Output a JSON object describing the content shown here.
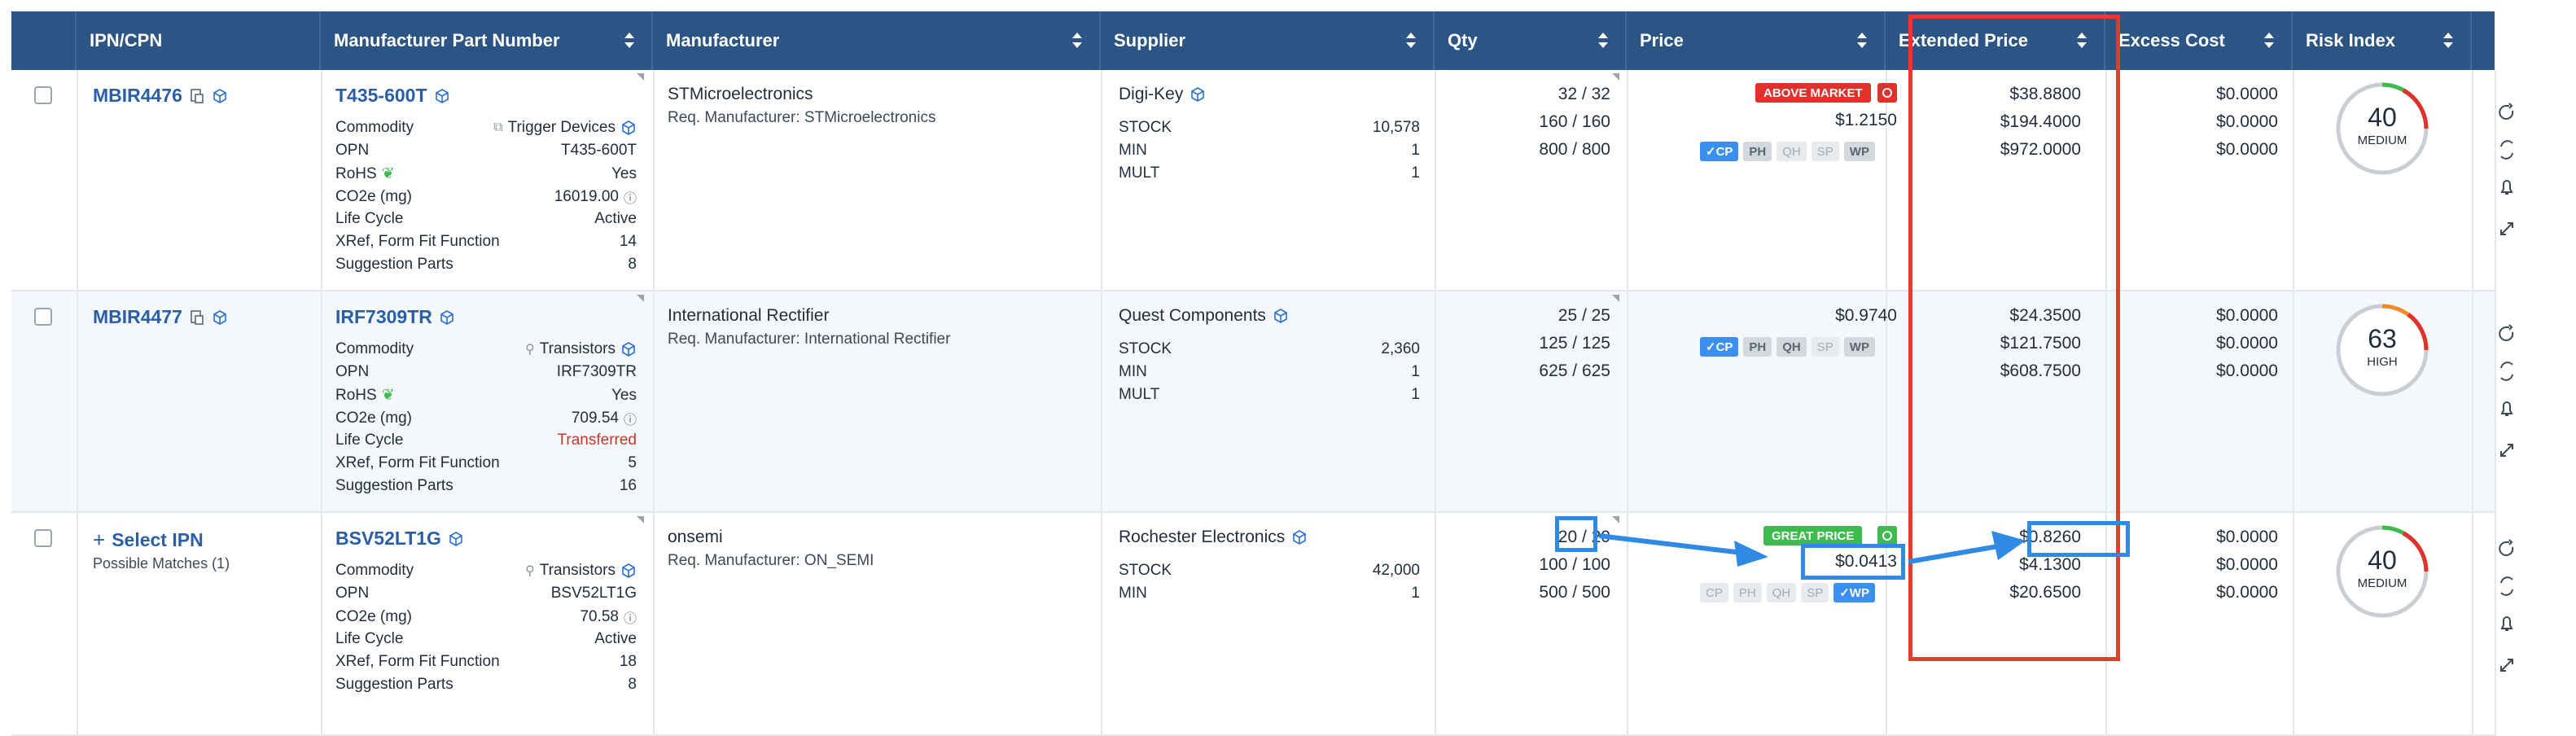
{
  "columns": [
    "IPN/CPN",
    "Manufacturer Part Number",
    "Manufacturer",
    "Supplier",
    "Qty",
    "Price",
    "Extended Price",
    "Excess Cost",
    "Risk Index"
  ],
  "rows": [
    {
      "ipn": "MBIR4476",
      "mpn": "T435-600T",
      "attrs": [
        {
          "k": "Commodity",
          "v": "Trigger Devices"
        },
        {
          "k": "OPN",
          "v": "T435-600T"
        },
        {
          "k": "RoHS",
          "v": "Yes"
        },
        {
          "k": "CO2e (mg)",
          "v": "16019.00"
        },
        {
          "k": "Life Cycle",
          "v": "Active"
        },
        {
          "k": "XRef, Form Fit Function",
          "v": "14"
        },
        {
          "k": "Suggestion Parts",
          "v": "8"
        }
      ],
      "manufacturer": "STMicroelectronics",
      "req_manufacturer": "Req. Manufacturer: STMicroelectronics",
      "supplier": "Digi-Key",
      "supplier_stats": [
        {
          "k": "STOCK",
          "v": "10,578"
        },
        {
          "k": "MIN",
          "v": "1"
        },
        {
          "k": "MULT",
          "v": "1"
        }
      ],
      "qty": [
        "32 / 32",
        "160 / 160",
        "800 / 800"
      ],
      "price_badge": "ABOVE MARKET",
      "price": "$1.2150",
      "price_chips": [
        "CP",
        "PH",
        "QH",
        "SP",
        "WP"
      ],
      "ext": [
        "$38.8800",
        "$194.4000",
        "$972.0000"
      ],
      "excess": [
        "$0.0000",
        "$0.0000",
        "$0.0000"
      ],
      "risk": 40,
      "risk_label": "MEDIUM"
    },
    {
      "ipn": "MBIR4477",
      "mpn": "IRF7309TR",
      "attrs": [
        {
          "k": "Commodity",
          "v": "Transistors"
        },
        {
          "k": "OPN",
          "v": "IRF7309TR"
        },
        {
          "k": "RoHS",
          "v": "Yes"
        },
        {
          "k": "CO2e (mg)",
          "v": "709.54"
        },
        {
          "k": "Life Cycle",
          "v": "Transferred"
        },
        {
          "k": "XRef, Form Fit Function",
          "v": "5"
        },
        {
          "k": "Suggestion Parts",
          "v": "16"
        }
      ],
      "manufacturer": "International Rectifier",
      "req_manufacturer": "Req. Manufacturer: International Rectifier",
      "supplier": "Quest Components",
      "supplier_stats": [
        {
          "k": "STOCK",
          "v": "2,360"
        },
        {
          "k": "MIN",
          "v": "1"
        },
        {
          "k": "MULT",
          "v": "1"
        }
      ],
      "qty": [
        "25 / 25",
        "125 / 125",
        "625 / 625"
      ],
      "price": "$0.9740",
      "price_chips": [
        "CP",
        "PH",
        "QH",
        "SP",
        "WP"
      ],
      "ext": [
        "$24.3500",
        "$121.7500",
        "$608.7500"
      ],
      "excess": [
        "$0.0000",
        "$0.0000",
        "$0.0000"
      ],
      "risk": 63,
      "risk_label": "HIGH"
    },
    {
      "ipn": "Select IPN",
      "ipn_sub": "Possible Matches (1)",
      "mpn": "BSV52LT1G",
      "attrs": [
        {
          "k": "Commodity",
          "v": "Transistors"
        },
        {
          "k": "OPN",
          "v": "BSV52LT1G"
        },
        {
          "k": "CO2e (mg)",
          "v": "70.58"
        },
        {
          "k": "Life Cycle",
          "v": "Active"
        },
        {
          "k": "XRef, Form Fit Function",
          "v": "18"
        },
        {
          "k": "Suggestion Parts",
          "v": "8"
        }
      ],
      "manufacturer": "onsemi",
      "req_manufacturer": "Req. Manufacturer: ON_SEMI",
      "supplier": "Rochester Electronics",
      "supplier_stats": [
        {
          "k": "STOCK",
          "v": "42,000"
        },
        {
          "k": "MIN",
          "v": "1"
        }
      ],
      "qty": [
        "20 / 20",
        "100 / 100",
        "500 / 500"
      ],
      "price_badge": "GREAT PRICE",
      "price": "$0.0413",
      "price_chips": [
        "CP",
        "PH",
        "QH",
        "SP",
        "WP"
      ],
      "ext": [
        "$0.8260",
        "$4.1300",
        "$20.6500"
      ],
      "excess": [
        "$0.0000",
        "$0.0000",
        "$0.0000"
      ],
      "risk": 40,
      "risk_label": "MEDIUM"
    }
  ],
  "colors": {
    "header": "#2c5484",
    "link": "#2a5ea8",
    "annot_red": "#e53b2c",
    "annot_blue": "#2f8ae6",
    "above_market": "#e0312b",
    "great_price": "#3dbb4f"
  }
}
